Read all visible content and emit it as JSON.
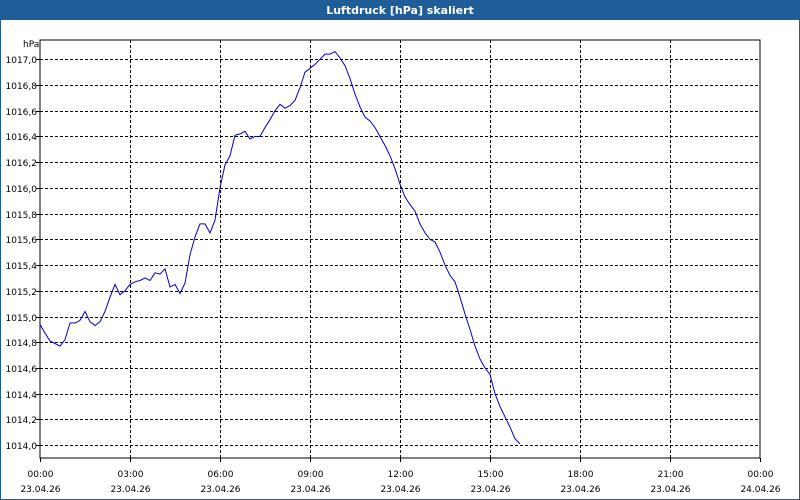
{
  "window": {
    "title": "Luftdruck [hPa] skaliert"
  },
  "colors": {
    "titlebar": "#1f5d99",
    "line": "#0000c8",
    "grid": "#000000"
  },
  "chart_data": {
    "type": "line",
    "title": "Luftdruck [hPa] skaliert",
    "ylabel": "hPa",
    "xlabel": "",
    "grid": true,
    "ylim": [
      1013.9,
      1017.15
    ],
    "xlim": [
      "23.04.26 00:00",
      "24.04.26 00:00"
    ],
    "yticks": [
      1014.0,
      1014.2,
      1014.4,
      1014.6,
      1014.8,
      1015.0,
      1015.2,
      1015.4,
      1015.6,
      1015.8,
      1016.0,
      1016.2,
      1016.4,
      1016.6,
      1016.8,
      1017.0
    ],
    "ytick_labels": [
      "1014,0",
      "1014,2",
      "1014,4",
      "1014,6",
      "1014,8",
      "1015,0",
      "1015,2",
      "1015,4",
      "1015,6",
      "1015,8",
      "1016,0",
      "1016,2",
      "1016,4",
      "1016,6",
      "1016,8",
      "1017,0"
    ],
    "xticks": [
      {
        "time": "00:00",
        "date": "23.04.26"
      },
      {
        "time": "03:00",
        "date": "23.04.26"
      },
      {
        "time": "06:00",
        "date": "23.04.26"
      },
      {
        "time": "09:00",
        "date": "23.04.26"
      },
      {
        "time": "12:00",
        "date": "23.04.26"
      },
      {
        "time": "15:00",
        "date": "23.04.26"
      },
      {
        "time": "18:00",
        "date": "23.04.26"
      },
      {
        "time": "21:00",
        "date": "23.04.26"
      },
      {
        "time": "00:00",
        "date": "24.04.26"
      }
    ],
    "series": [
      {
        "x": [
          "23.04.26 00:00",
          "23.04.26 00:10",
          "23.04.26 00:20",
          "23.04.26 00:40",
          "23.04.26 00:50",
          "23.04.26 01:00",
          "23.04.26 01:10",
          "23.04.26 01:20",
          "23.04.26 01:30",
          "23.04.26 01:40",
          "23.04.26 01:50",
          "23.04.26 02:00",
          "23.04.26 02:10",
          "23.04.26 02:20",
          "23.04.26 02:30",
          "23.04.26 02:40",
          "23.04.26 02:50",
          "23.04.26 03:00",
          "23.04.26 03:10",
          "23.04.26 03:20",
          "23.04.26 03:30",
          "23.04.26 03:40",
          "23.04.26 03:50",
          "23.04.26 04:00",
          "23.04.26 04:10",
          "23.04.26 04:20",
          "23.04.26 04:30",
          "23.04.26 04:40",
          "23.04.26 04:50",
          "23.04.26 05:00",
          "23.04.26 05:10",
          "23.04.26 05:20",
          "23.04.26 05:30",
          "23.04.26 05:40",
          "23.04.26 05:50",
          "23.04.26 06:00",
          "23.04.26 06:10",
          "23.04.26 06:20",
          "23.04.26 06:30",
          "23.04.26 06:40",
          "23.04.26 06:50",
          "23.04.26 07:00",
          "23.04.26 07:10",
          "23.04.26 07:20",
          "23.04.26 07:30",
          "23.04.26 07:40",
          "23.04.26 07:50",
          "23.04.26 08:00",
          "23.04.26 08:10",
          "23.04.26 08:20",
          "23.04.26 08:30",
          "23.04.26 08:40",
          "23.04.26 08:50",
          "23.04.26 09:00",
          "23.04.26 09:10",
          "23.04.26 09:20",
          "23.04.26 09:30",
          "23.04.26 09:40",
          "23.04.26 09:50",
          "23.04.26 10:00",
          "23.04.26 10:10",
          "23.04.26 10:20",
          "23.04.26 10:30",
          "23.04.26 10:40",
          "23.04.26 10:50",
          "23.04.26 11:00",
          "23.04.26 11:10",
          "23.04.26 11:20",
          "23.04.26 11:30",
          "23.04.26 11:40",
          "23.04.26 11:50",
          "23.04.26 12:00",
          "23.04.26 12:10",
          "23.04.26 12:20",
          "23.04.26 12:30",
          "23.04.26 12:40",
          "23.04.26 12:50",
          "23.04.26 13:00",
          "23.04.26 13:10",
          "23.04.26 13:20",
          "23.04.26 13:30",
          "23.04.26 13:40",
          "23.04.26 13:50",
          "23.04.26 14:00",
          "23.04.26 14:10",
          "23.04.26 14:20",
          "23.04.26 14:30",
          "23.04.26 14:40",
          "23.04.26 14:50",
          "23.04.26 15:00",
          "23.04.26 15:10",
          "23.04.26 15:20",
          "23.04.26 15:30",
          "23.04.26 15:40",
          "23.04.26 15:50",
          "23.04.26 16:00"
        ],
        "y": [
          1014.94,
          1014.87,
          1014.81,
          1014.77,
          1014.82,
          1014.95,
          1014.95,
          1014.97,
          1015.04,
          1014.96,
          1014.93,
          1014.96,
          1015.04,
          1015.15,
          1015.25,
          1015.17,
          1015.2,
          1015.25,
          1015.27,
          1015.28,
          1015.3,
          1015.28,
          1015.34,
          1015.33,
          1015.37,
          1015.23,
          1015.25,
          1015.18,
          1015.26,
          1015.48,
          1015.62,
          1015.72,
          1015.72,
          1015.65,
          1015.75,
          1016.0,
          1016.18,
          1016.25,
          1016.41,
          1016.42,
          1016.44,
          1016.38,
          1016.4,
          1016.4,
          1016.47,
          1016.53,
          1016.6,
          1016.65,
          1016.62,
          1016.64,
          1016.68,
          1016.78,
          1016.9,
          1016.93,
          1016.96,
          1017.0,
          1017.04,
          1017.04,
          1017.06,
          1017.01,
          1016.95,
          1016.85,
          1016.73,
          1016.63,
          1016.55,
          1016.52,
          1016.47,
          1016.4,
          1016.33,
          1016.25,
          1016.15,
          1016.03,
          1015.93,
          1015.87,
          1015.82,
          1015.72,
          1015.65,
          1015.6,
          1015.58,
          1015.5,
          1015.4,
          1015.32,
          1015.27,
          1015.15,
          1015.02,
          1014.9,
          1014.77,
          1014.67,
          1014.6,
          1014.55,
          1014.4,
          1014.3,
          1014.22,
          1014.14,
          1014.05,
          1014.01
        ]
      }
    ]
  }
}
